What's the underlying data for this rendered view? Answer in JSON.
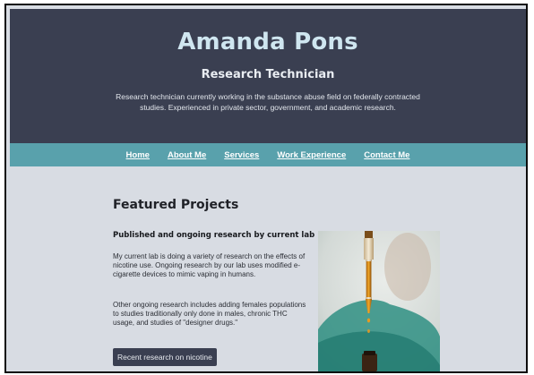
{
  "header": {
    "name": "Amanda Pons",
    "role": "Research Technician",
    "tagline": "Research technician currently working in the substance abuse field on federally contracted studies. Experienced in private sector, government, and academic research."
  },
  "nav": {
    "items": [
      {
        "label": "Home"
      },
      {
        "label": "About Me"
      },
      {
        "label": "Services"
      },
      {
        "label": "Work Experience"
      },
      {
        "label": "Contact Me"
      }
    ]
  },
  "featured": {
    "section_title": "Featured Projects",
    "project": {
      "title": "Published and ongoing research by current lab",
      "paragraph_1": "My current lab is doing a variety of research on the effects of nicotine use. Ongoing research by our lab uses modified e-cigarette devices to mimic vaping in humans.",
      "paragraph_2": "Other ongoing research includes adding females populations to studies traditionally only done in males, chronic THC usage, and studies of \"designer drugs.\"",
      "button_label": "Recent research on nicotine"
    }
  },
  "colors": {
    "header_bg": "#3a3f51",
    "nav_bg": "#59a1ac",
    "page_bg": "#d8dce3",
    "button_bg": "#3a3f51"
  }
}
